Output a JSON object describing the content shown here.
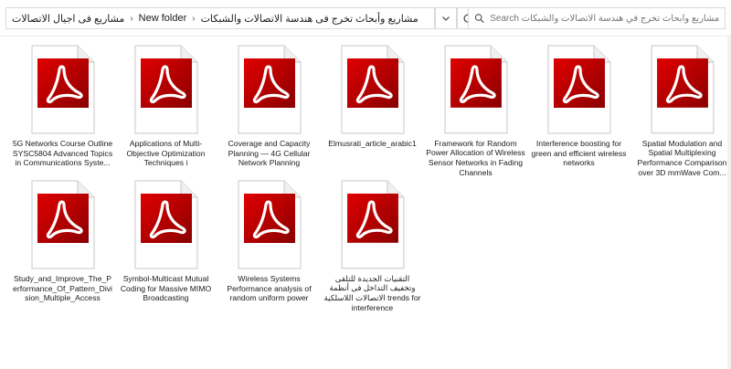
{
  "address": {
    "breadcrumbs": [
      "مشاريع فى اجيال الاتصالات",
      "New folder",
      "مشاريع وأبحاث تخرج فى هندسة الاتصالات والشبكات"
    ]
  },
  "search": {
    "placeholder": "Search مشاريع وأبحاث تخرج في هندسة الاتصالات والشبكات"
  },
  "icons": {
    "chevron": "chevron-down-icon",
    "refresh": "refresh-icon",
    "search": "search-icon",
    "file": "pdf-file-icon"
  },
  "colors": {
    "pdf_red": "#c40000",
    "pdf_dark": "#7a0000"
  },
  "files": [
    {
      "name": "5G Networks Course Outline SYSC5804 Advanced Topics in Communications Syste..."
    },
    {
      "name": "Applications of Multi-Objective Optimization Techniques i"
    },
    {
      "name": "Coverage and Capacity Planning — 4G Cellular Network Planning"
    },
    {
      "name": "Elmusrati_article_arabic1"
    },
    {
      "name": "Framework for Random Power Allocation of Wireless Sensor Networks in Fading Channels"
    },
    {
      "name": "Interference boosting for green and efficient wireless networks"
    },
    {
      "name": "Spatial Modulation and Spatial Multiplexing Performance Comparison over 3D mmWave Com..."
    },
    {
      "name": "Study_and_Improve_The_Performance_Of_Pattern_Division_Multiple_Access"
    },
    {
      "name": "Symbol-Multicast Mutual Coding for Massive MIMO Broadcasting"
    },
    {
      "name": "Wireless Systems Performance analysis of random uniform power"
    },
    {
      "name": "التقنيات الجديدة للتلقى وتخفيف التداخل فى أنظمة الاتصالات اللاسلكية trends for interference"
    }
  ]
}
